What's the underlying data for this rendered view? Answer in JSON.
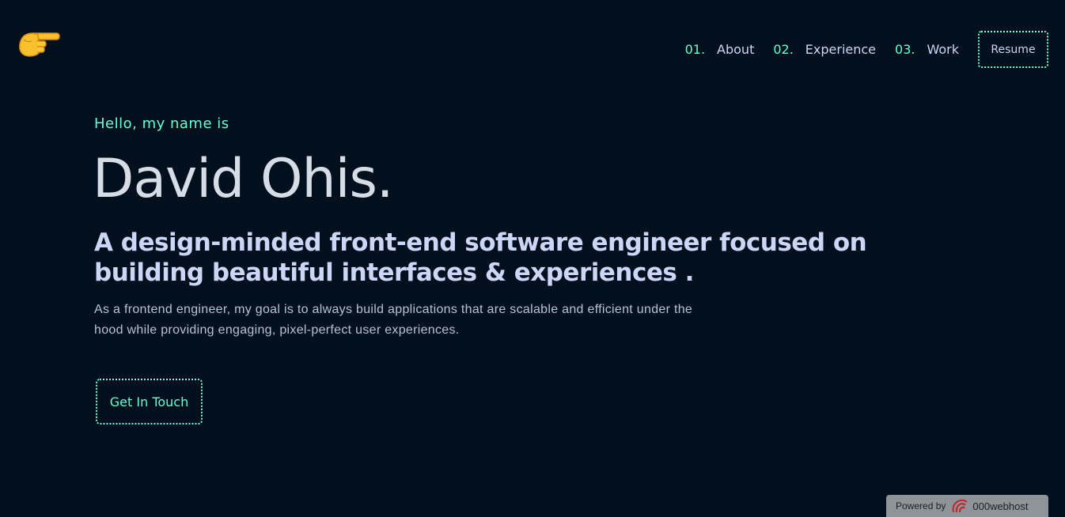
{
  "header": {
    "logo_icon": "pointing-hand-icon",
    "nav": [
      {
        "number": "01.",
        "label": "About"
      },
      {
        "number": "02.",
        "label": "Experience"
      },
      {
        "number": "03.",
        "label": "Work"
      }
    ],
    "resume_label": "Resume"
  },
  "hero": {
    "greeting": "Hello, my name is",
    "name": "David Ohis.",
    "tagline": "A design-minded front-end software engineer focused on building beautiful interfaces & experiences .",
    "description": "As a frontend engineer, my goal is to always build applications that are scalable and efficient under the hood while providing engaging, pixel-perfect user experiences.",
    "cta_label": "Get In Touch"
  },
  "footer_badge": {
    "powered_by": "Powered by",
    "host_name": "000webhost",
    "host_icon": "000webhost-logo-icon"
  },
  "colors": {
    "background": "#020f1d",
    "accent": "#64ffda",
    "heading": "#d6dde6",
    "text": "#ccd6f6"
  }
}
